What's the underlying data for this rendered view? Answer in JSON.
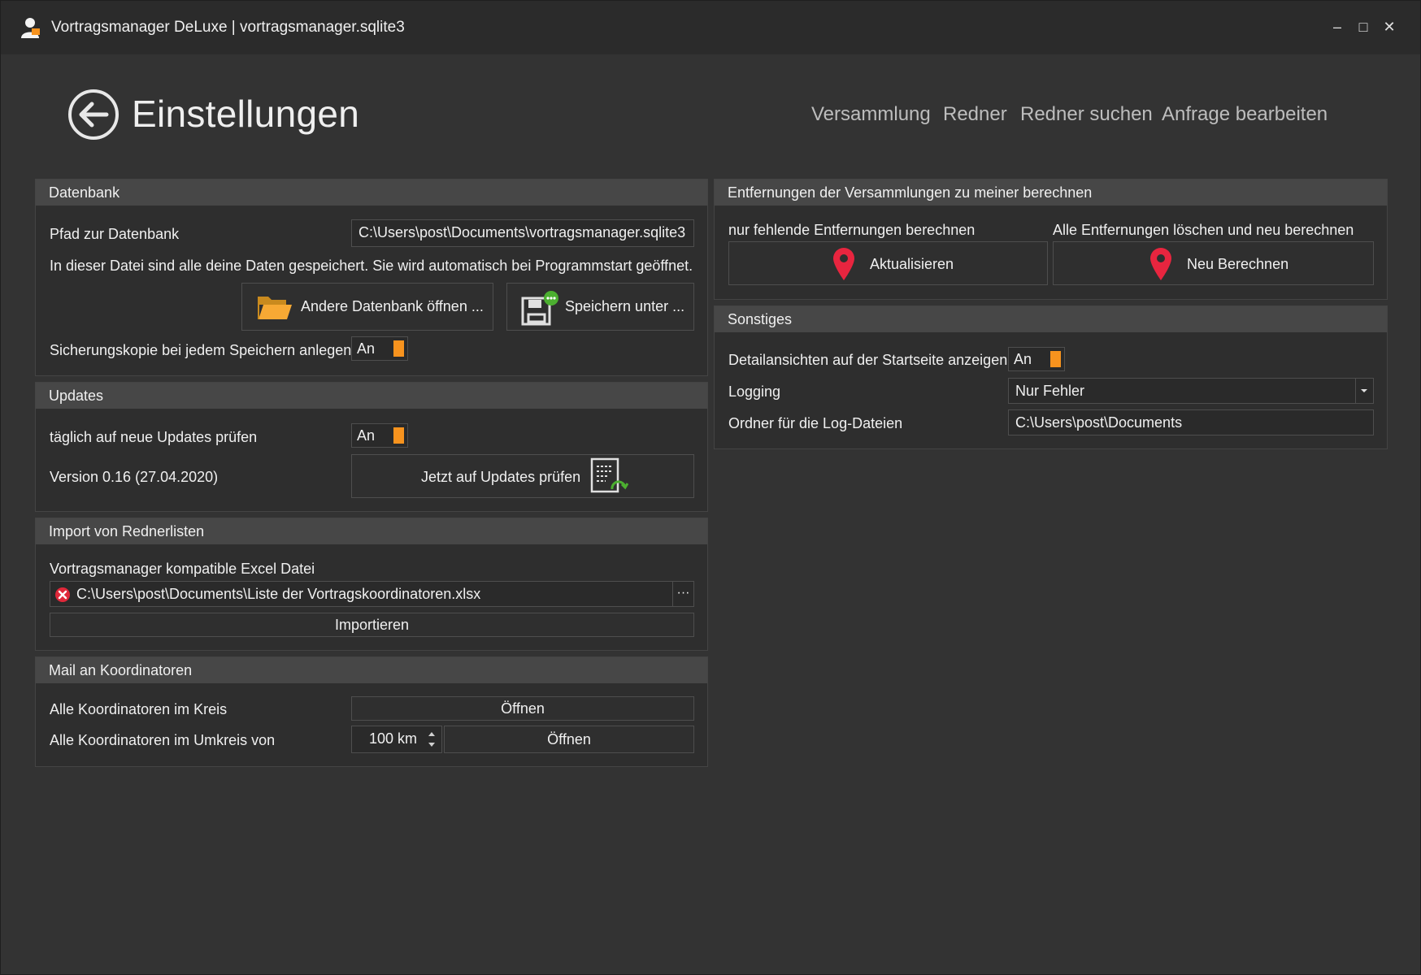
{
  "window": {
    "title": "Vortragsmanager DeLuxe | vortragsmanager.sqlite3",
    "minimize": "–",
    "maximize": "□",
    "close": "✕"
  },
  "header": {
    "title": "Einstellungen",
    "nav": [
      "Versammlung",
      "Redner",
      "Redner suchen",
      "Anfrage bearbeiten"
    ]
  },
  "datenbank": {
    "heading": "Datenbank",
    "path_label": "Pfad zur Datenbank",
    "path_value": "C:\\Users\\post\\Documents\\vortragsmanager.sqlite3",
    "info": "In dieser Datei sind alle deine Daten gespeichert. Sie wird automatisch bei Programmstart geöffnet.",
    "open_button": "Andere Datenbank öffnen ...",
    "save_button": "Speichern unter ...",
    "backup_label": "Sicherungskopie bei jedem Speichern anlegen",
    "backup_value": "An"
  },
  "updates": {
    "heading": "Updates",
    "daily_label": "täglich auf neue Updates prüfen",
    "daily_value": "An",
    "version": "Version 0.16 (27.04.2020)",
    "check_button": "Jetzt auf Updates prüfen"
  },
  "import": {
    "heading": "Import von Rednerlisten",
    "file_label": "Vortragsmanager kompatible Excel Datei",
    "file_value": "C:\\Users\\post\\Documents\\Liste der Vortragskoordinatoren.xlsx",
    "browse": "···",
    "import_button": "Importieren"
  },
  "mail": {
    "heading": "Mail an Koordinatoren",
    "kreis_label": "Alle Koordinatoren im Kreis",
    "kreis_button": "Öffnen",
    "umkreis_label": "Alle Koordinatoren im Umkreis von",
    "umkreis_value": "100 km",
    "umkreis_button": "Öffnen"
  },
  "entfernungen": {
    "heading": "Entfernungen der Versammlungen zu meiner berechnen",
    "missing_label": "nur fehlende Entfernungen berechnen",
    "update_button": "Aktualisieren",
    "all_label": "Alle Entfernungen löschen und neu berechnen",
    "recalc_button": "Neu Berechnen"
  },
  "sonstiges": {
    "heading": "Sonstiges",
    "detail_label": "Detailansichten auf der Startseite anzeigen",
    "detail_value": "An",
    "logging_label": "Logging",
    "logging_value": "Nur Fehler",
    "logfolder_label": "Ordner für die Log-Dateien",
    "logfolder_value": "C:\\Users\\post\\Documents"
  },
  "colors": {
    "background": "#333333",
    "panel": "#2e2e2e",
    "panel_header": "#474747",
    "toggle_accent": "#f7931e",
    "pin": "#e8253f",
    "error": "#e0283a"
  }
}
